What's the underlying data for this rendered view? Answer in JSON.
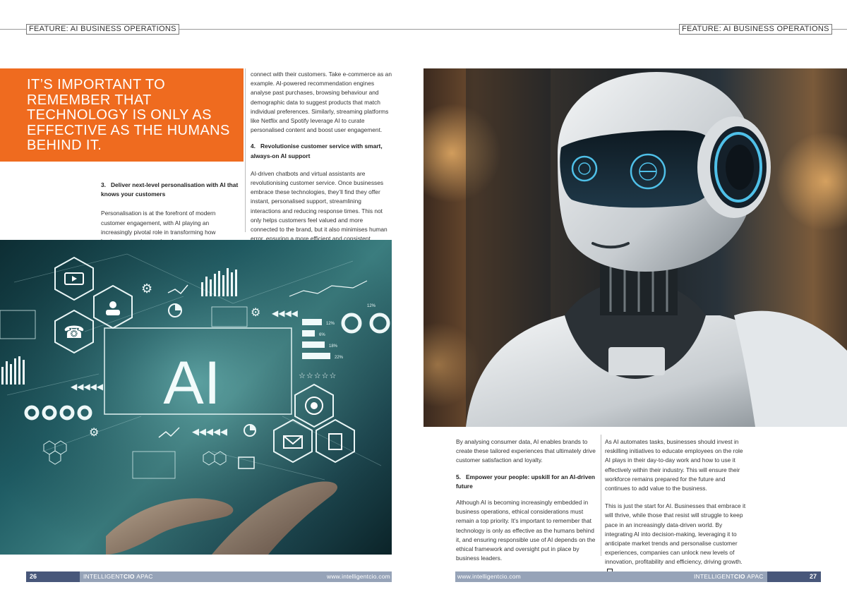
{
  "header": {
    "section_left": "FEATURE: AI BUSINESS OPERATIONS",
    "section_right": "FEATURE: AI BUSINESS OPERATIONS"
  },
  "pull_quote": "IT’S IMPORTANT TO REMEMBER THAT TECHNOLOGY IS ONLY AS EFFECTIVE AS THE HUMANS BEHIND IT.",
  "left_col": {
    "heading3": "3.   Deliver next-level personalisation with AI that knows your customers",
    "para1": "Personalisation is at the forefront of modern customer engagement, with AI playing an increasingly pivotal role in transforming how businesses understand and"
  },
  "mid_col": {
    "para1": "connect with their customers. Take e-commerce as an example. AI-powered recommendation engines analyse past purchases, browsing behaviour and demographic data to suggest products that match individual preferences. Similarly, streaming platforms like Netflix and Spotify leverage AI to curate personalised content and boost user engagement.",
    "heading4": "4.   Revolutionise customer service with smart, always-on AI support",
    "para2": "AI-driven chatbots and virtual assistants are revolutionising customer service. Once businesses embrace these technologies, they’ll find they offer instant, personalised support, streamlining interactions and reducing response times. This not only helps customers feel valued and more connected to the brand, but it also minimises human error, ensuring a more efficient and consistent experience."
  },
  "ai_image": {
    "big_label": "AI",
    "pct_labels": [
      "12%",
      "6%",
      "18%",
      "22%",
      "12%"
    ]
  },
  "right_col1": {
    "para1": "By analysing consumer data, AI enables brands to create these tailored experiences that ultimately drive customer satisfaction and loyalty.",
    "heading5": "5.   Empower your people: upskill for an AI-driven future",
    "para2": "Although AI is becoming increasingly embedded in business operations, ethical considerations must remain a top priority. It’s important to remember that technology is only as effective as the humans behind it, and ensuring responsible use of AI depends on the ethical framework and oversight put in place by business leaders."
  },
  "right_col2": {
    "para1": "As AI automates tasks, businesses should invest in reskilling initiatives to educate employees on the role AI plays in their day-to-day work and how to use it effectively within their industry. This will ensure their workforce remains prepared for the future and continues to add value to the business.",
    "para2": "This is just the start for AI. Businesses that embrace it will thrive, while those that resist will struggle to keep pace in an increasingly data-driven world. By integrating AI into decision-making, leveraging it to anticipate market trends and personalise customer experiences, companies can unlock new levels of innovation, profitability and efficiency, driving growth."
  },
  "footer": {
    "page_left": "26",
    "page_right": "27",
    "brand_prefix": "INTELLIGENT",
    "brand_bold": "CIO",
    "brand_suffix": "APAC",
    "url": "www.intelligentcio.com"
  },
  "colors": {
    "accent_orange": "#ef6b1f",
    "footer_bar": "#96a3b8",
    "footer_page": "#48577a"
  }
}
